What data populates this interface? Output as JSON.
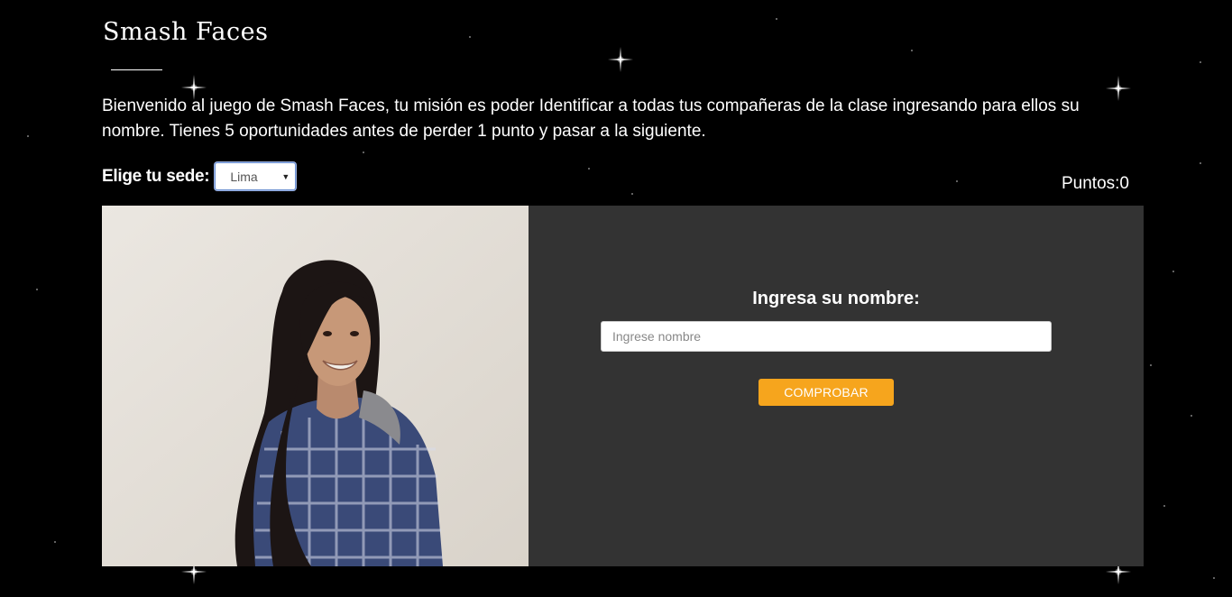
{
  "app": {
    "title": "Smash Faces"
  },
  "intro": {
    "text": "Bienvenido al juego de Smash Faces, tu misión es poder Identificar a todas tus compañeras de la clase ingresando para ellos su nombre. Tienes 5 oportunidades antes de perder 1 punto y pasar a la siguiente."
  },
  "sede": {
    "label": "Elige tu sede:",
    "selected": "Lima"
  },
  "score": {
    "label": "Puntos:",
    "value": "0"
  },
  "game": {
    "question": "Ingresa su nombre:",
    "input_placeholder": "Ingrese nombre",
    "input_value": "",
    "check_label": "COMPROBAR"
  },
  "colors": {
    "background": "#000000",
    "panel": "#333333",
    "button": "#f6a51d",
    "text": "#ffffff"
  },
  "icons": {
    "select_caret": "caret-down-icon",
    "photo": "student-photo"
  }
}
